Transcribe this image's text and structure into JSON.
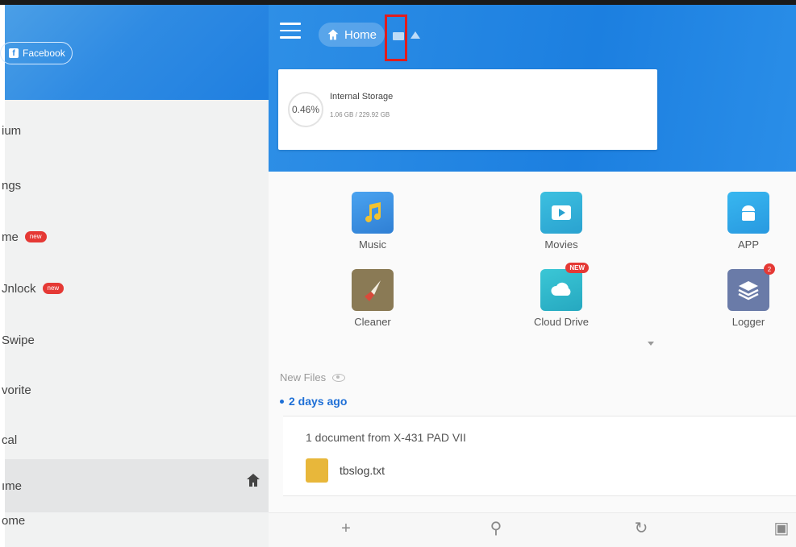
{
  "sidebar": {
    "facebook_label": "Facebook",
    "items": [
      {
        "label": "ium",
        "badge": ""
      },
      {
        "label": "ngs",
        "badge": ""
      },
      {
        "label": "me",
        "badge": "new"
      },
      {
        "label": "Jnlock",
        "badge": "new"
      },
      {
        "label": "Swipe",
        "badge": ""
      },
      {
        "label": "vorite",
        "badge": ""
      },
      {
        "label": "cal",
        "badge": ""
      },
      {
        "label": "ıme",
        "badge": ""
      },
      {
        "label": "ome",
        "badge": ""
      }
    ]
  },
  "header": {
    "breadcrumb_home": "Home"
  },
  "storage": {
    "percent": "0.46%",
    "title": "Internal Storage",
    "usage": "1.06 GB / 229.92 GB"
  },
  "categories": [
    {
      "label": "Music",
      "icon": "music-note-icon"
    },
    {
      "label": "Movies",
      "icon": "play-icon"
    },
    {
      "label": "APP",
      "icon": "android-icon"
    },
    {
      "label": "Cleaner",
      "icon": "broom-icon"
    },
    {
      "label": "Cloud Drive",
      "icon": "cloud-icon",
      "tag": "NEW"
    },
    {
      "label": "Logger",
      "icon": "layers-icon",
      "tag": "2"
    }
  ],
  "new_files": {
    "label": "New Files",
    "group_date": "2 days ago",
    "card_title": "1 document from X-431 PAD VII",
    "file_name": "tbslog.txt"
  },
  "colors": {
    "accent": "#1f7fe0",
    "badge": "#e53935",
    "highlight": "#e11d1d"
  }
}
